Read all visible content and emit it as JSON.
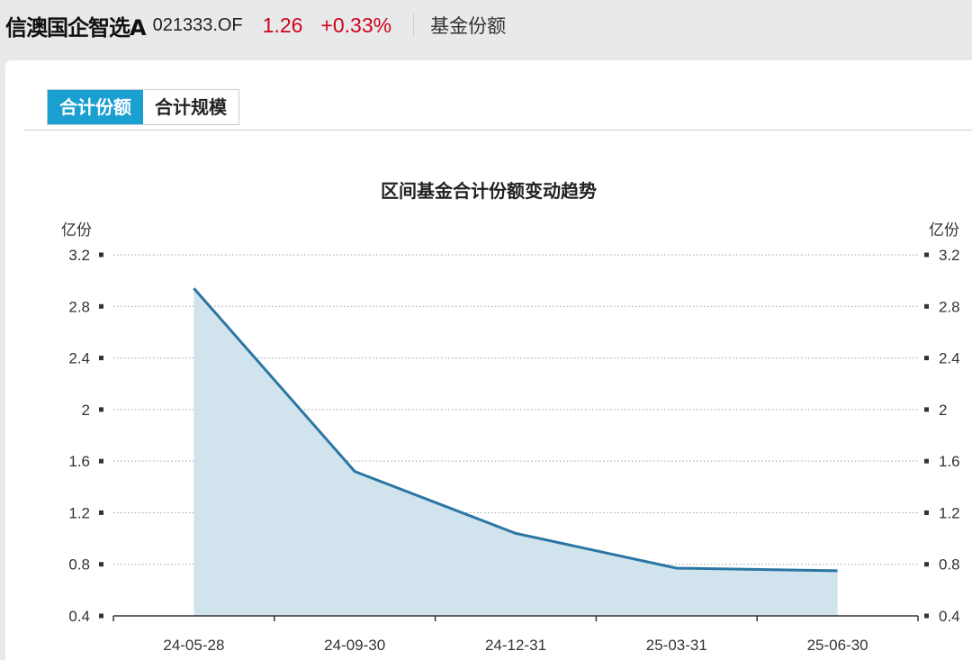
{
  "header": {
    "fund_name": "信澳国企智选A",
    "fund_code": "021333.OF",
    "nav": "1.26",
    "change": "+0.33%",
    "section": "基金份额"
  },
  "tabs": [
    {
      "label": "合计份额",
      "active": true
    },
    {
      "label": "合计规模",
      "active": false
    }
  ],
  "colors": {
    "accent": "#1a9fd1",
    "line": "#2a76a4",
    "area": "#d1e3ec",
    "up": "#d0021b"
  },
  "chart_data": {
    "type": "area",
    "title": "区间基金合计份额变动趋势",
    "ylabel_left": "亿份",
    "ylabel_right": "亿份",
    "categories": [
      "24-05-28",
      "24-09-30",
      "24-12-31",
      "25-03-31",
      "25-06-30"
    ],
    "series": [
      {
        "values": [
          2.94,
          1.52,
          1.04,
          0.77,
          0.75
        ]
      }
    ],
    "yticks": [
      "0.4",
      "0.8",
      "1.2",
      "1.6",
      "2",
      "2.4",
      "2.8",
      "3.2"
    ],
    "ylim": [
      0.4,
      3.2
    ],
    "grid": "horizontal-dotted"
  }
}
